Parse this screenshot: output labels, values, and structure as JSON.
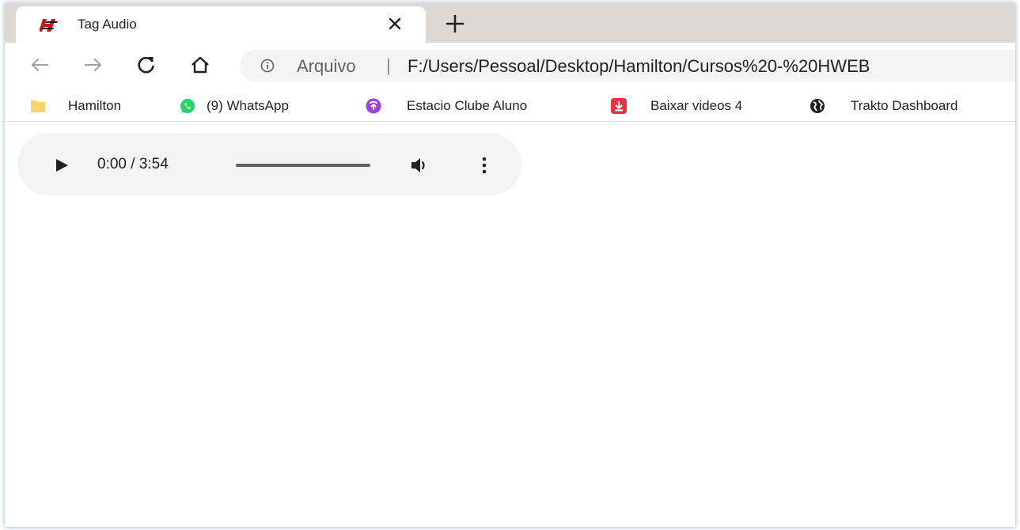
{
  "tab": {
    "title": "Tag Audio",
    "close_icon": "close-icon",
    "favicon": "hamilton-logo-icon",
    "favicon_color": "#e8141d"
  },
  "toolbar": {
    "back_icon": "back-arrow-icon",
    "forward_icon": "forward-arrow-icon",
    "reload_icon": "reload-icon",
    "home_icon": "home-icon"
  },
  "omnibox": {
    "scheme_label": "Arquivo",
    "separator": "|",
    "url": "F:/Users/Pessoal/Desktop/Hamilton/Cursos%20-%20HWEB"
  },
  "bookmarks": [
    {
      "label": "Hamilton",
      "icon": "folder-icon",
      "color": "#f6d66b"
    },
    {
      "label": "(9) WhatsApp",
      "icon": "whatsapp-icon",
      "color": "#25d366"
    },
    {
      "label": "Estacio Clube Aluno",
      "icon": "estacio-icon",
      "color": "#a03ee0"
    },
    {
      "label": "Baixar videos 4",
      "icon": "download-icon",
      "color": "#e8323c"
    },
    {
      "label": "Trakto Dashboard",
      "icon": "globe-icon",
      "color": "#202124"
    }
  ],
  "audio": {
    "current_time": "0:00",
    "duration": "3:54",
    "time_display": "0:00 / 3:54",
    "progress": 0,
    "muted": false
  },
  "colors": {
    "tabstrip_bg": "#dfd9d6",
    "player_bg": "#f1f3f4",
    "text": "#202124"
  }
}
